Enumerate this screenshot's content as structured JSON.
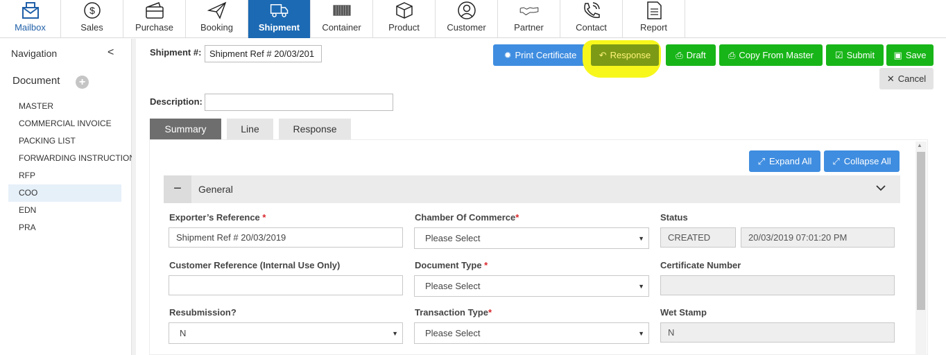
{
  "nav": {
    "items": [
      {
        "label": "Mailbox",
        "icon": "mailbox-icon"
      },
      {
        "label": "Sales",
        "icon": "dollar-icon"
      },
      {
        "label": "Purchase",
        "icon": "wallet-icon"
      },
      {
        "label": "Booking",
        "icon": "paper-plane-icon"
      },
      {
        "label": "Shipment",
        "icon": "truck-icon"
      },
      {
        "label": "Container",
        "icon": "container-icon"
      },
      {
        "label": "Product",
        "icon": "box-icon"
      },
      {
        "label": "Customer",
        "icon": "user-icon"
      },
      {
        "label": "Partner",
        "icon": "handshake-icon"
      },
      {
        "label": "Contact",
        "icon": "phone-icon"
      },
      {
        "label": "Report",
        "icon": "report-icon"
      }
    ],
    "active": "Shipment"
  },
  "sidebar": {
    "title": "Navigation",
    "collapse_glyph": "<",
    "section": "Document",
    "add_glyph": "+",
    "items": [
      "MASTER",
      "COMMERCIAL INVOICE",
      "PACKING LIST",
      "FORWARDING INSTRUCTION",
      "RFP",
      "COO",
      "EDN",
      "PRA"
    ],
    "selected": "COO"
  },
  "header": {
    "shipment_label": "Shipment #:",
    "shipment_value": "Shipment Ref # 20/03/201",
    "description_label": "Description:",
    "description_value": ""
  },
  "actions": {
    "print_certificate": "Print Certificate",
    "response": "Response",
    "draft": "Draft",
    "copy_from_master": "Copy From Master",
    "submit": "Submit",
    "save": "Save",
    "cancel": "Cancel"
  },
  "tabs": [
    "Summary",
    "Line",
    "Response"
  ],
  "active_tab": "Summary",
  "panel": {
    "expand_all": "Expand All",
    "collapse_all": "Collapse All",
    "section_title": "General",
    "section_toggle": "−",
    "fields": {
      "exporters_reference": {
        "label": "Exporter’s Reference",
        "required": "*",
        "value": "Shipment Ref # 20/03/2019"
      },
      "chamber_of_commerce": {
        "label": "Chamber Of Commerce",
        "required": "*",
        "value": "Please Select"
      },
      "status": {
        "label": "Status",
        "value": "CREATED",
        "timestamp": "20/03/2019 07:01:20 PM"
      },
      "customer_reference": {
        "label": "Customer Reference ",
        "label_bold": "(Internal Use Only)",
        "value": ""
      },
      "document_type": {
        "label": "Document Type ",
        "required": "*",
        "value": "Please Select"
      },
      "certificate_number": {
        "label": "Certificate Number",
        "value": ""
      },
      "resubmission": {
        "label": "Resubmission?",
        "value": "N"
      },
      "transaction_type": {
        "label": "Transaction Type",
        "required": "*",
        "value": "Please Select"
      },
      "wet_stamp": {
        "label": "Wet Stamp",
        "value": "N"
      }
    }
  },
  "colors": {
    "primary": "#1c6ab4",
    "button_blue": "#3f8de0",
    "button_green": "#18b518",
    "highlight": "#f7f71c",
    "required": "#d9262b"
  }
}
